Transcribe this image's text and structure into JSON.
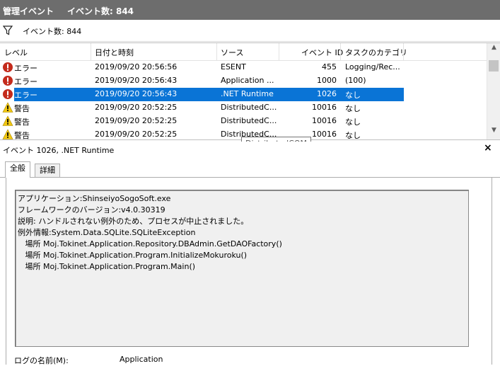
{
  "titlebar": {
    "title": "管理イベント",
    "count": "イベント数: 844"
  },
  "filterbar": {
    "icon": "filter-icon",
    "text": "イベント数: 844"
  },
  "grid": {
    "columns": [
      "レベル",
      "日付と時刻",
      "ソース",
      "イベント ID",
      "タスクのカテゴリ"
    ],
    "rows": [
      {
        "level": "エラー",
        "icon": "error-icon",
        "datetime": "2019/09/20 20:56:56",
        "source": "ESENT",
        "event_id": "455",
        "category": "Logging/Rec..."
      },
      {
        "level": "エラー",
        "icon": "error-icon",
        "datetime": "2019/09/20 20:56:43",
        "source": "Application ...",
        "event_id": "1000",
        "category": "(100)"
      },
      {
        "level": "エラー",
        "icon": "error-icon",
        "datetime": "2019/09/20 20:56:43",
        "source": ".NET Runtime",
        "event_id": "1026",
        "category": "なし",
        "selected": true
      },
      {
        "level": "警告",
        "icon": "warning-icon",
        "datetime": "2019/09/20 20:52:25",
        "source": "DistributedC...",
        "event_id": "10016",
        "category": "なし"
      },
      {
        "level": "警告",
        "icon": "warning-icon",
        "datetime": "2019/09/20 20:52:25",
        "source": "DistributedC...",
        "event_id": "10016",
        "category": "なし"
      },
      {
        "level": "警告",
        "icon": "warning-icon",
        "datetime": "2019/09/20 20:52:25",
        "source": "DistributedC...",
        "event_id": "10016",
        "category": "なし"
      }
    ]
  },
  "tooltip": "DistributedCOM",
  "detail": {
    "header": "イベント 1026, .NET Runtime",
    "close": "×",
    "tabs": [
      "全般",
      "詳細"
    ],
    "message_lines": [
      "アプリケーション:ShinseiyoSogoSoft.exe",
      "フレームワークのバージョン:v4.0.30319",
      "説明: ハンドルされない例外のため、プロセスが中止されました。",
      "例外情報:System.Data.SQLite.SQLiteException",
      "   場所 Moj.Tokinet.Application.Repository.DBAdmin.GetDAOFactory()",
      "   場所 Moj.Tokinet.Application.Program.InitializeMokuroku()",
      "   場所 Moj.Tokinet.Application.Program.Main()"
    ],
    "logname_label": "ログの名前(M):",
    "logname_value": "Application"
  },
  "colors": {
    "titlebar": "#6d6d6d",
    "selection": "#0a74d6",
    "error": "#c42b1c",
    "warning": "#f2c811"
  }
}
